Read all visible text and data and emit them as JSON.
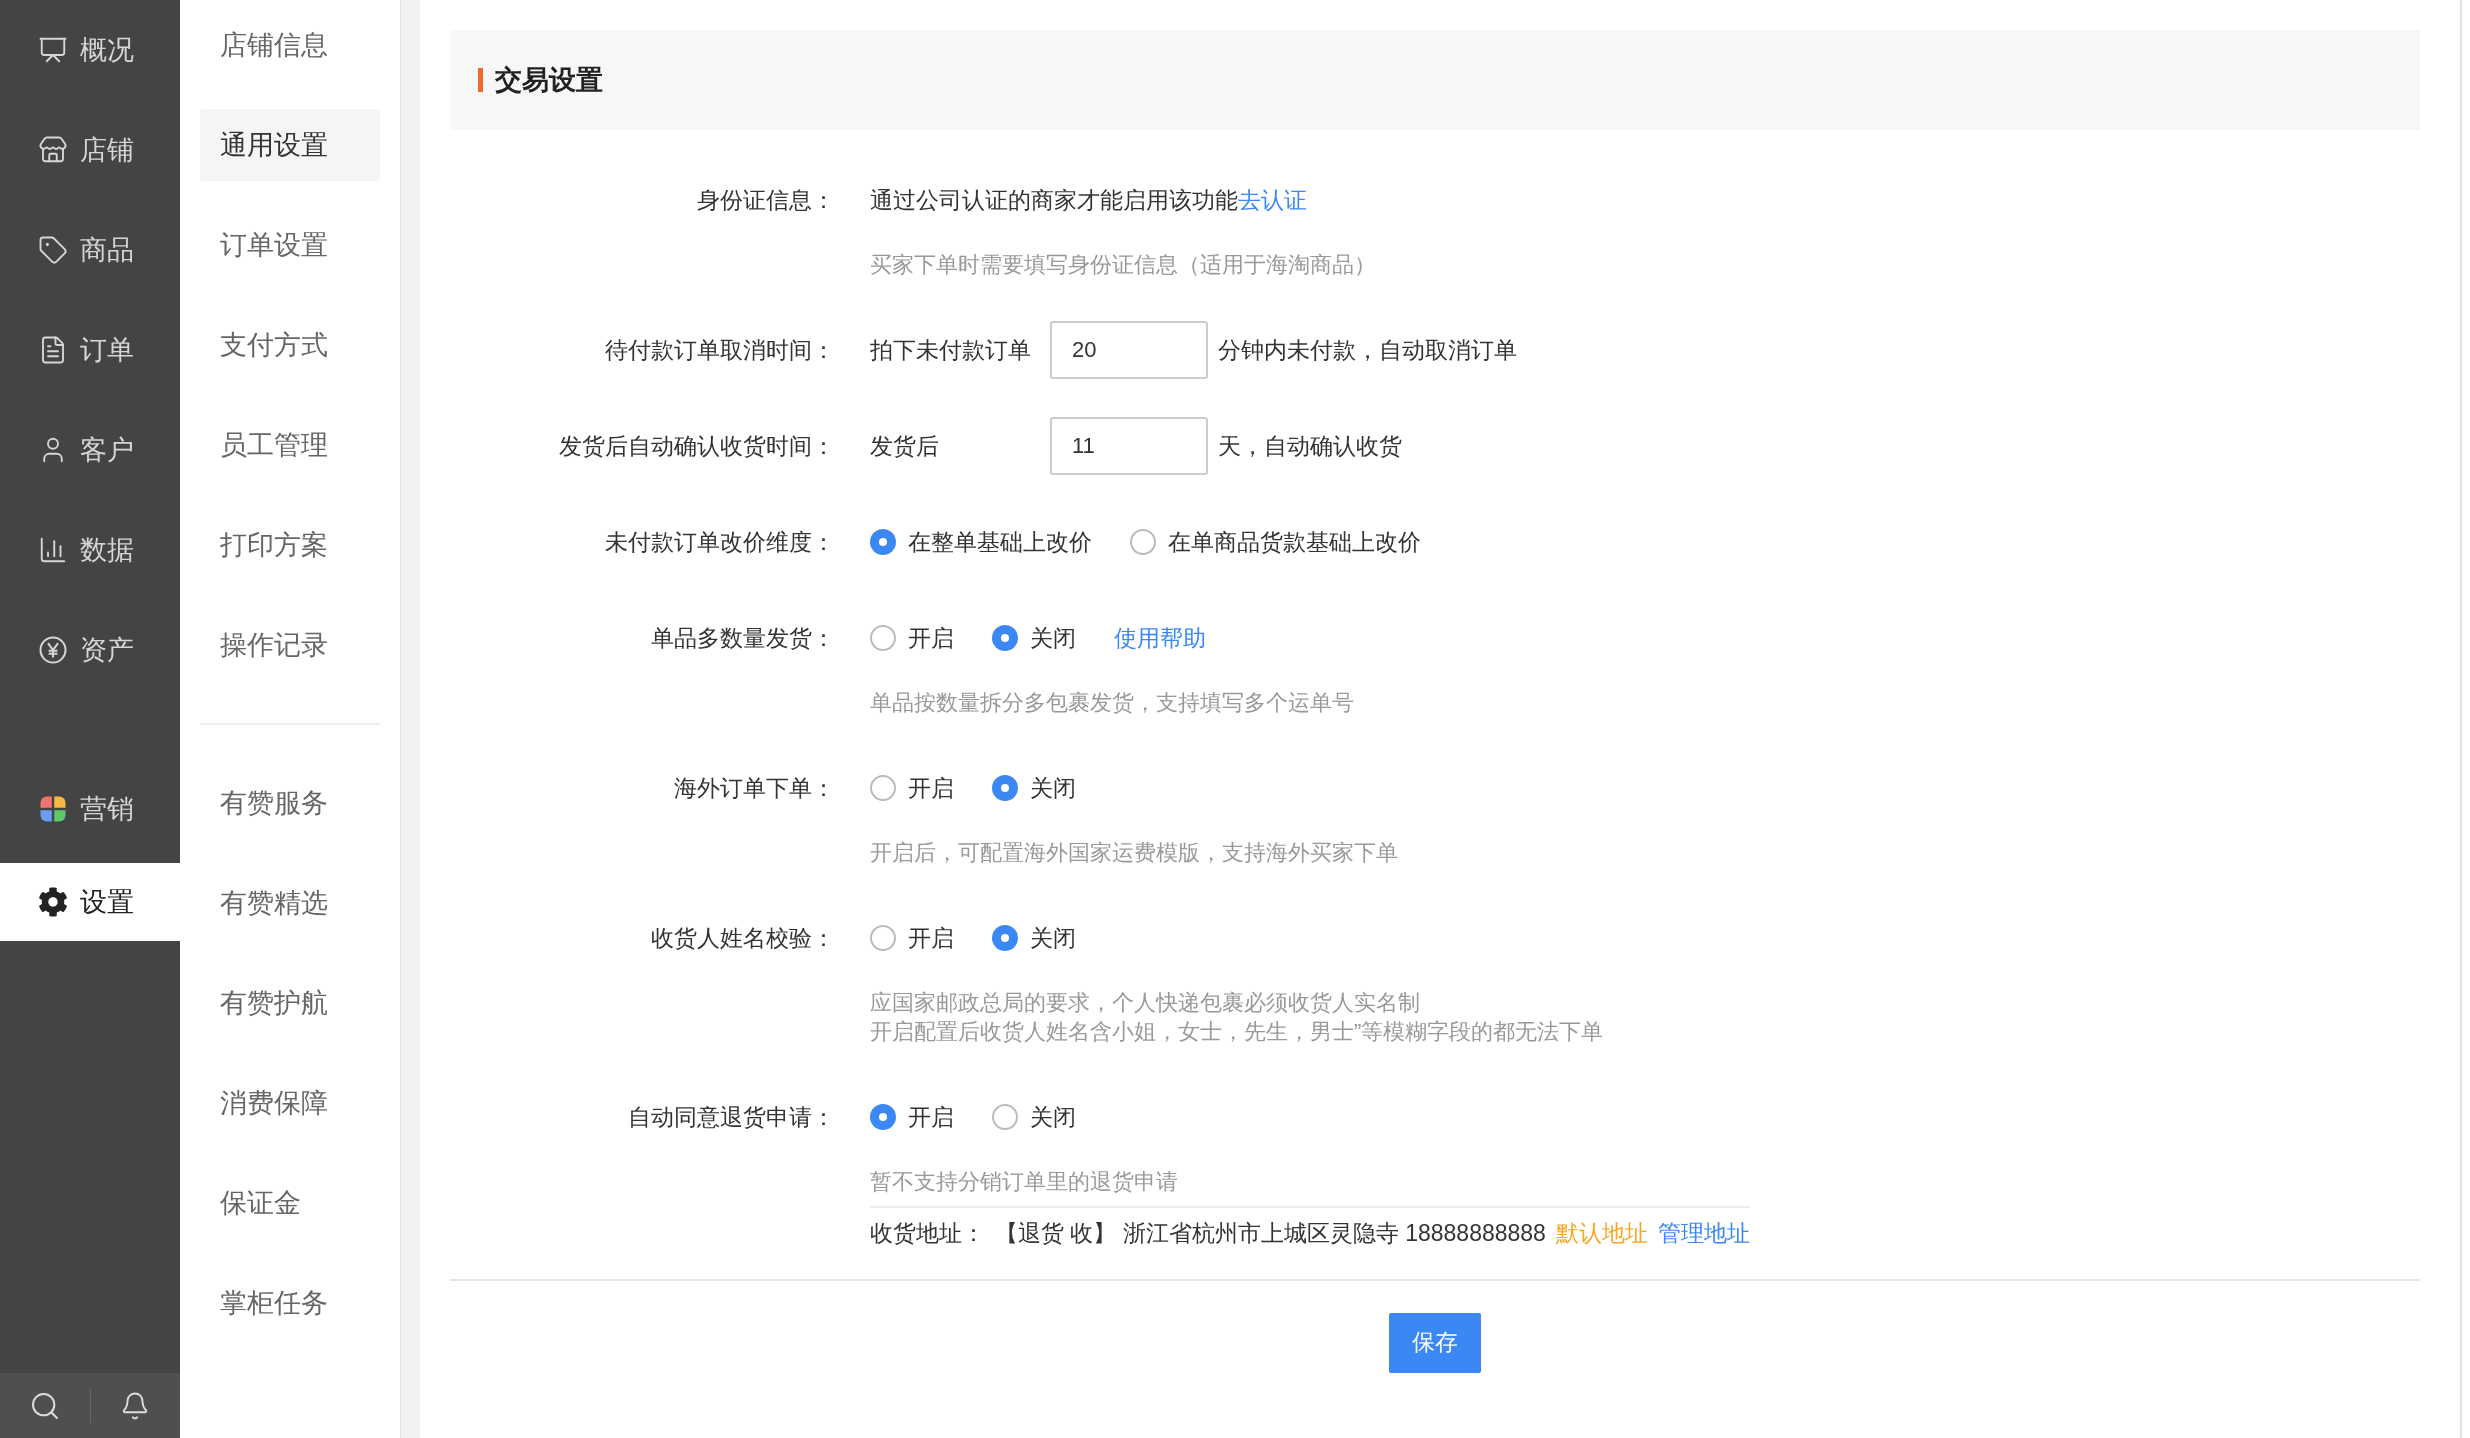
{
  "main_nav": {
    "groups": [
      [
        {
          "label": "概况",
          "selected": false
        },
        {
          "label": "店铺",
          "selected": false
        },
        {
          "label": "商品",
          "selected": false
        },
        {
          "label": "订单",
          "selected": false
        },
        {
          "label": "客户",
          "selected": false
        },
        {
          "label": "数据",
          "selected": false
        },
        {
          "label": "资产",
          "selected": false
        }
      ],
      [
        {
          "label": "营销",
          "selected": false
        },
        {
          "label": "设置",
          "selected": true
        }
      ]
    ]
  },
  "sub_nav": {
    "groups": [
      [
        {
          "label": "店铺信息",
          "selected": false
        },
        {
          "label": "通用设置",
          "selected": true
        },
        {
          "label": "订单设置",
          "selected": false
        },
        {
          "label": "支付方式",
          "selected": false
        },
        {
          "label": "员工管理",
          "selected": false
        },
        {
          "label": "打印方案",
          "selected": false
        },
        {
          "label": "操作记录",
          "selected": false
        }
      ],
      [
        {
          "label": "有赞服务",
          "selected": false
        },
        {
          "label": "有赞精选",
          "selected": false
        },
        {
          "label": "有赞护航",
          "selected": false
        },
        {
          "label": "消费保障",
          "selected": false
        },
        {
          "label": "保证金",
          "selected": false
        },
        {
          "label": "掌柜任务",
          "selected": false
        }
      ]
    ]
  },
  "section": {
    "title": "交易设置",
    "rows": [
      {
        "kind": "text",
        "label": "身份证信息：",
        "text": "通过公司认证的商家才能启用该功能",
        "link": "去认证",
        "hints": [
          "买家下单时需要填写身份证信息（适用于海淘商品）"
        ]
      },
      {
        "kind": "input",
        "label": "待付款订单取消时间：",
        "prefix": "拍下未付款订单",
        "value": "20",
        "suffix": "分钟内未付款，自动取消订单"
      },
      {
        "kind": "input",
        "label": "发货后自动确认收货时间：",
        "prefix": "发货后",
        "value": "11",
        "suffix": "天，自动确认收货"
      },
      {
        "kind": "radio",
        "label": "未付款订单改价维度：",
        "options": [
          {
            "label": "在整单基础上改价",
            "selected": true
          },
          {
            "label": "在单商品货款基础上改价",
            "selected": false
          }
        ]
      },
      {
        "kind": "radio",
        "label": "单品多数量发货：",
        "options": [
          {
            "label": "开启",
            "selected": false
          },
          {
            "label": "关闭",
            "selected": true
          }
        ],
        "link": "使用帮助",
        "hints": [
          "单品按数量拆分多包裹发货，支持填写多个运单号"
        ]
      },
      {
        "kind": "radio",
        "label": "海外订单下单：",
        "options": [
          {
            "label": "开启",
            "selected": false
          },
          {
            "label": "关闭",
            "selected": true
          }
        ],
        "hints": [
          "开启后，可配置海外国家运费模版，支持海外买家下单"
        ]
      },
      {
        "kind": "radio",
        "label": "收货人姓名校验：",
        "options": [
          {
            "label": "开启",
            "selected": false
          },
          {
            "label": "关闭",
            "selected": true
          }
        ],
        "hints": [
          "应国家邮政总局的要求，个人快递包裹必须收货人实名制",
          "开启配置后收货人姓名含小姐，女士，先生，男士”等模糊字段的都无法下单"
        ]
      },
      {
        "kind": "radio",
        "label": "自动同意退货申请：",
        "options": [
          {
            "label": "开启",
            "selected": true
          },
          {
            "label": "关闭",
            "selected": false
          }
        ],
        "hints": [
          "暂不支持分销订单里的退货申请"
        ],
        "address": {
          "label": "收货地址：",
          "text": "【退货 收】 浙江省杭州市上城区灵隐寺 18888888888",
          "tag": "默认地址",
          "link": "管理地址"
        }
      }
    ]
  },
  "save_button": "保存"
}
